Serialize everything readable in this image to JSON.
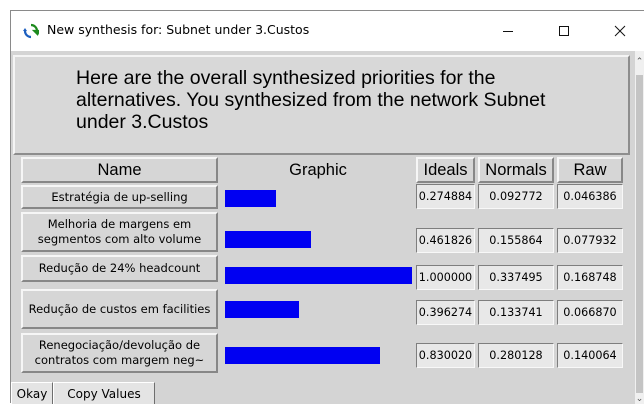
{
  "window": {
    "title": "New synthesis for: Subnet under 3.Custos",
    "app_icon": "sync-arrows-icon"
  },
  "header": {
    "text": "Here are the overall synthesized priorities for the alternatives.  You synthesized from the network Subnet under 3.Custos"
  },
  "columns": {
    "name": "Name",
    "graphic": "Graphic",
    "ideals": "Ideals",
    "normals": "Normals",
    "raw": "Raw"
  },
  "rows": [
    {
      "name": "Estratégia de up-selling",
      "ideal": "0.274884",
      "normal": "0.092772",
      "raw": "0.046386",
      "bar_fraction": 0.274884
    },
    {
      "name": "Melhoria de margens em segmentos com alto volume",
      "ideal": "0.461826",
      "normal": "0.155864",
      "raw": "0.077932",
      "bar_fraction": 0.461826
    },
    {
      "name": "Redução de 24% headcount",
      "ideal": "1.000000",
      "normal": "0.337495",
      "raw": "0.168748",
      "bar_fraction": 1.0
    },
    {
      "name": "Redução de custos em facilities",
      "ideal": "0.396274",
      "normal": "0.133741",
      "raw": "0.066870",
      "bar_fraction": 0.396274
    },
    {
      "name": "Renegociação/devolução de contratos com margem neg~",
      "ideal": "0.830020",
      "normal": "0.280128",
      "raw": "0.140064",
      "bar_fraction": 0.83002
    }
  ],
  "buttons": {
    "okay": "Okay",
    "copy_values": "Copy Values"
  },
  "colors": {
    "bar": "#0000f2",
    "panel": "#d4d4d4"
  }
}
